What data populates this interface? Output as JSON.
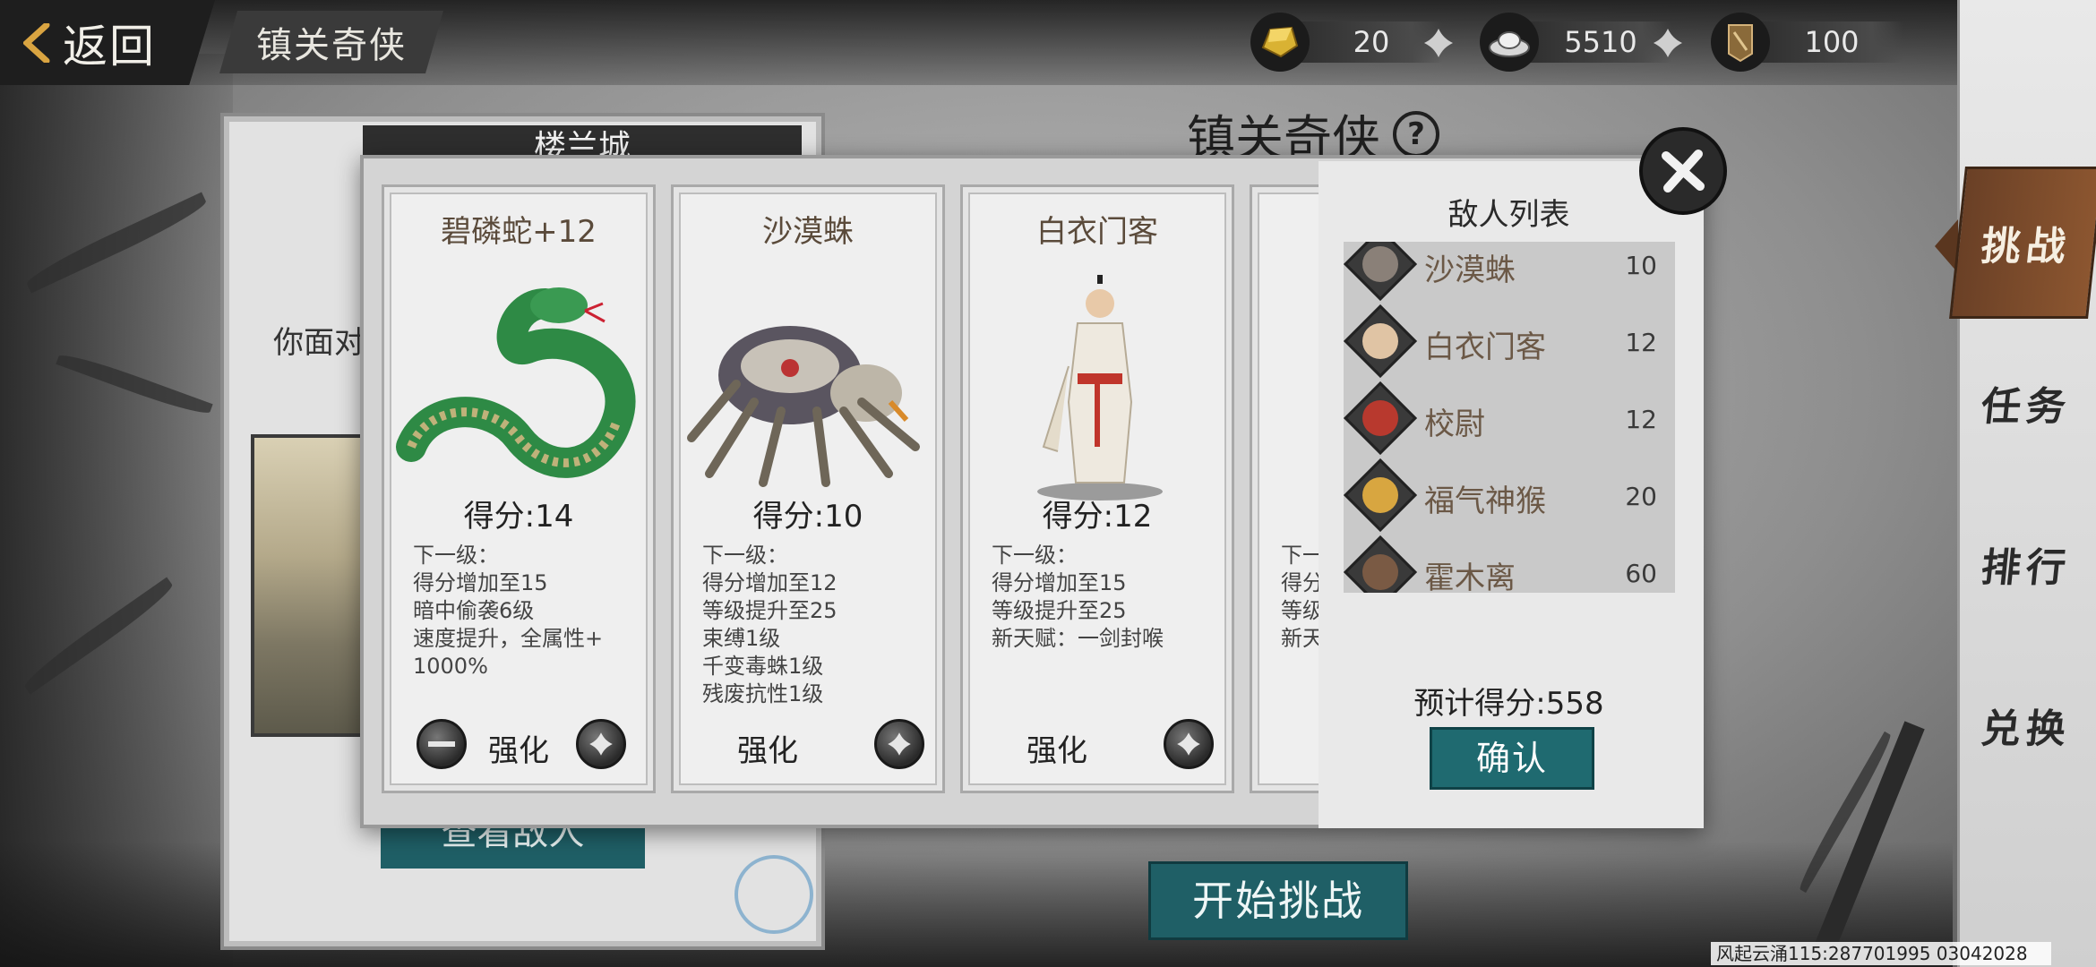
{
  "topbar": {
    "back_label": "返回",
    "page_tag": "镇关奇侠",
    "resources": [
      {
        "icon": "gold-ingot-icon",
        "value": "20"
      },
      {
        "icon": "silver-ingot-icon",
        "value": "5510"
      },
      {
        "icon": "token-badge-icon",
        "value": "100"
      }
    ]
  },
  "right_nav": [
    "挑战",
    "任务",
    "排行",
    "兑换"
  ],
  "background_page": {
    "panel_title": "楼兰城",
    "panel_text": "你面对",
    "view_enemy_button": "查看敌人",
    "heading": "镇关奇侠",
    "help_symbol": "?",
    "start_button": "开始挑战"
  },
  "modal": {
    "cards": [
      {
        "name": "碧磷蛇+12",
        "score": "得分:14",
        "desc": [
          "下一级：",
          "得分增加至15",
          "暗中偷袭6级",
          "速度提升，全属性+",
          "1000%"
        ],
        "enhance": "强化"
      },
      {
        "name": "沙漠蛛",
        "score": "得分:10",
        "desc": [
          "下一级：",
          "得分增加至12",
          "等级提升至25",
          "束缚1级",
          "千变毒蛛1级",
          "残废抗性1级"
        ],
        "enhance": "强化"
      },
      {
        "name": "白衣门客",
        "score": "得分:12",
        "desc": [
          "下一级：",
          "得分增加至15",
          "等级提升至25",
          "新天赋：一剑封喉"
        ],
        "enhance": "强化"
      },
      {
        "name": "",
        "score": "",
        "desc": [
          "下一",
          "得分",
          "等级",
          "新天"
        ],
        "enhance": ""
      }
    ],
    "enemy_list_title": "敌人列表",
    "enemies": [
      {
        "name": "沙漠蛛",
        "score": "10"
      },
      {
        "name": "白衣门客",
        "score": "12"
      },
      {
        "name": "校尉",
        "score": "12"
      },
      {
        "name": "福气神猴",
        "score": "20"
      },
      {
        "name": "霍木离",
        "score": "60"
      }
    ],
    "estimated_score": "预计得分:558",
    "confirm_button": "确认"
  },
  "watermark": "风起云涌115:287701995  03042028",
  "colors": {
    "teal_button": "#1f6a70",
    "active_nav": "#7a4a2a",
    "enemy_name": "#6b5846"
  }
}
